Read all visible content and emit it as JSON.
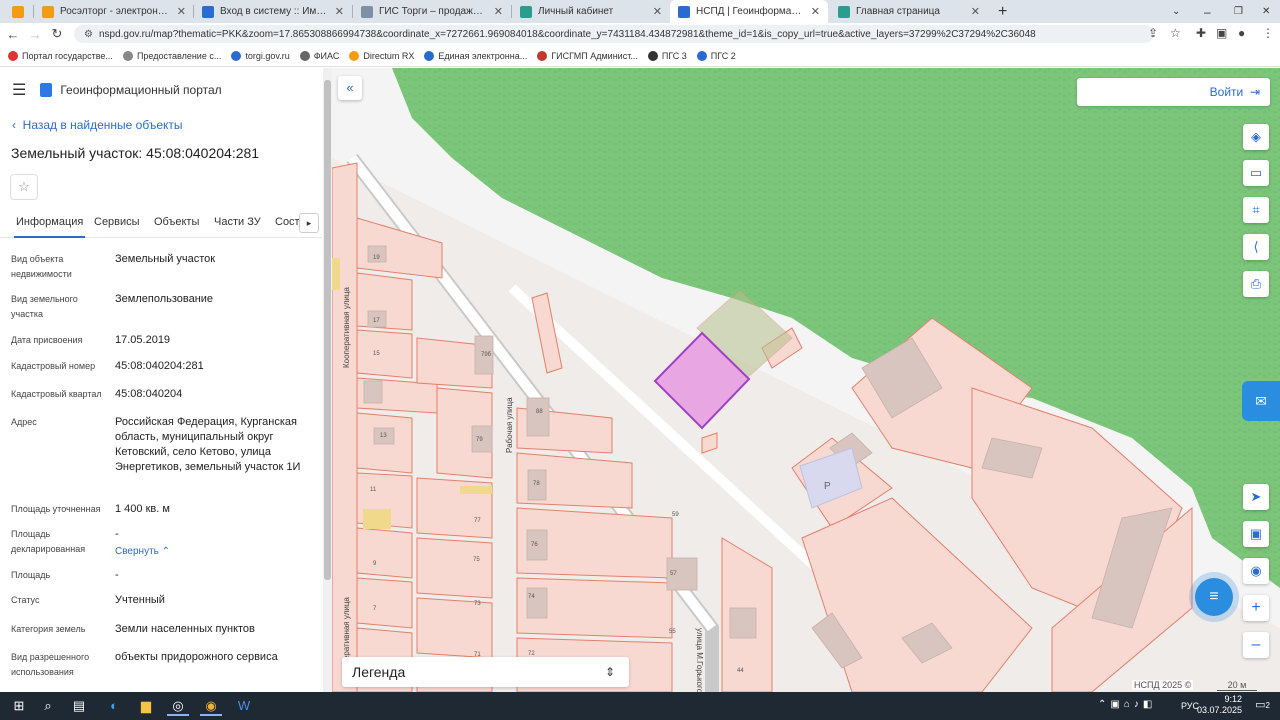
{
  "browser": {
    "tabs": [
      {
        "title": "Росэлторг - электронная торгов",
        "icon_color": "#f39c12"
      },
      {
        "title": "Вход в систему :: Имущественн",
        "icon_color": "#2a6bd0"
      },
      {
        "title": "ГИС Торги – продажи государст",
        "icon_color": "#7f8fa6"
      },
      {
        "title": "Личный кабинет",
        "icon_color": "#2a9d8f"
      },
      {
        "title": "НСПД | Геоинформационный п",
        "icon_color": "#2a6bd0"
      },
      {
        "title": "Главная страница",
        "icon_color": "#2a9d8f"
      }
    ],
    "url": "nspd.gov.ru/map?thematic=PKK&zoom=17.865308866994738&coordinate_x=7272661.969084018&coordinate_y=7431184.434872981&theme_id=1&is_copy_url=true&active_layers=37299%2C37294%2C36048",
    "bookmarks": [
      {
        "label": "Портал государстве...",
        "color": "#d33"
      },
      {
        "label": "Предоставление с...",
        "color": "#888"
      },
      {
        "label": "torgi.gov.ru",
        "color": "#2a6bd0"
      },
      {
        "label": "ФИАС",
        "color": "#666"
      },
      {
        "label": "Directum RX",
        "color": "#f39c12"
      },
      {
        "label": "Единая электронна...",
        "color": "#2a6bd0"
      },
      {
        "label": "ГИСГМП Админист...",
        "color": "#c0392b"
      },
      {
        "label": "ПГС 3",
        "color": "#333"
      },
      {
        "label": "ПГС 2",
        "color": "#2a6bd0"
      }
    ]
  },
  "panel": {
    "app_title": "Геоинформационный портал",
    "back_label": "Назад в найденные объекты",
    "object_title": "Земельный участок: 45:08:040204:281",
    "tabs": [
      "Информация",
      "Сервисы",
      "Объекты",
      "Части ЗУ",
      "Соста"
    ],
    "fields": [
      {
        "label": "Вид объекта недвижимости",
        "value": "Земельный участок"
      },
      {
        "label": "Вид земельного участка",
        "value": "Землепользование"
      },
      {
        "label": "Дата присвоения",
        "value": "17.05.2019"
      },
      {
        "label": "Кадастровый номер",
        "value": "45:08:040204:281"
      },
      {
        "label": "Кадастровый квартал",
        "value": "45:08:040204"
      },
      {
        "label": "Адрес",
        "value": "Российская Федерация, Курганская область, муниципальный округ Кетовский, село Кетово, улица Энергетиков, земельный участок 1И"
      },
      {
        "label": "Площадь уточненная",
        "value": "1 400 кв. м"
      },
      {
        "label": "Площадь декларированная",
        "value": "-"
      },
      {
        "label": "Площадь",
        "value": "-"
      },
      {
        "label": "Статус",
        "value": "Учтенный"
      },
      {
        "label": "Категория земель",
        "value": "Земли населенных пунктов"
      },
      {
        "label": "Вид разрешенного использования",
        "value": "объекты придорожного сервиса"
      }
    ],
    "collapse_label": "Свернуть"
  },
  "map": {
    "login_label": "Войти",
    "legend_label": "Легенда",
    "copyright": "НСПД 2025 ©",
    "scale": "20 м",
    "street_labels": [
      "Кооперативная улица",
      "Рабочая улица",
      "улица М.Горького",
      "Кооперативная улица"
    ],
    "parcel_numbers": [
      "19",
      "17",
      "15",
      "13",
      "11",
      "9",
      "7",
      "79б",
      "79",
      "77",
      "75",
      "73",
      "71",
      "88",
      "78",
      "76",
      "74",
      "72",
      "59",
      "57",
      "55",
      "44"
    ],
    "parking_label": "P",
    "colors": {
      "forest": "#7bc67a",
      "parcel_fill": "#f7d9d2",
      "parcel_stroke": "#e57f6a",
      "selected": "#a23fc7",
      "building": "#d9c5bf"
    }
  },
  "taskbar": {
    "lang": "РУС",
    "time": "9:12",
    "date": "03.07.2025",
    "notifications": "2"
  }
}
